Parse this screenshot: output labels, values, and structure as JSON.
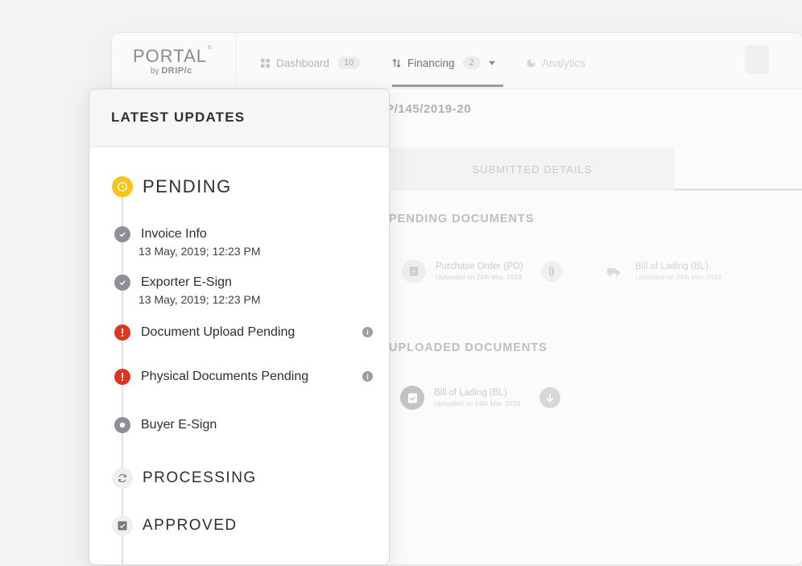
{
  "app": {
    "logo": {
      "word": "PORTAL",
      "sup": "B",
      "by": "by",
      "brand": "DRIP/c"
    },
    "nav": [
      {
        "label": "Dashboard",
        "badge": "10"
      },
      {
        "label": "Financing",
        "badge": "2"
      },
      {
        "label": "Analytics"
      }
    ],
    "title": "P/145/2019-20",
    "subtab": "SUBMITTED DETAILS",
    "pending_heading": "PENDING DOCUMENTS",
    "pending_docs": [
      {
        "name": "Purchase Order (PO)",
        "meta": "Uploaded on 24th Mar, 2018"
      },
      {
        "name": "Bill of Lading (BL)",
        "meta": "Uploaded on 24th Mar, 2018"
      }
    ],
    "uploaded_heading": "UPLOADED DOCUMENTS",
    "uploaded_docs": [
      {
        "name": "Bill of Lading (BL)",
        "meta": "Uploaded on 24th Mar, 2018"
      }
    ]
  },
  "panel": {
    "title": "LATEST UPDATES",
    "stages": {
      "pending": "PENDING",
      "processing": "PROCESSING",
      "approved": "APPROVED"
    },
    "steps": [
      {
        "label": "Invoice Info",
        "time": "13 May, 2019; 12:23 PM",
        "status": "done"
      },
      {
        "label": "Exporter E-Sign",
        "time": "13 May, 2019; 12:23 PM",
        "status": "done"
      },
      {
        "label": "Document Upload Pending",
        "status": "error"
      },
      {
        "label": "Physical Documents Pending",
        "status": "error"
      },
      {
        "label": "Buyer E-Sign",
        "status": "current"
      }
    ]
  },
  "colors": {
    "pending": "#f7c31a",
    "done": "#8e9096",
    "error": "#e0341e",
    "current": "#8e9096"
  },
  "icons": {
    "pending": "clock-icon",
    "done": "check-icon",
    "error": "exclamation-icon",
    "current": "dot-icon",
    "processing": "refresh-icon",
    "approved": "checkbox-icon",
    "info": "info-icon"
  }
}
